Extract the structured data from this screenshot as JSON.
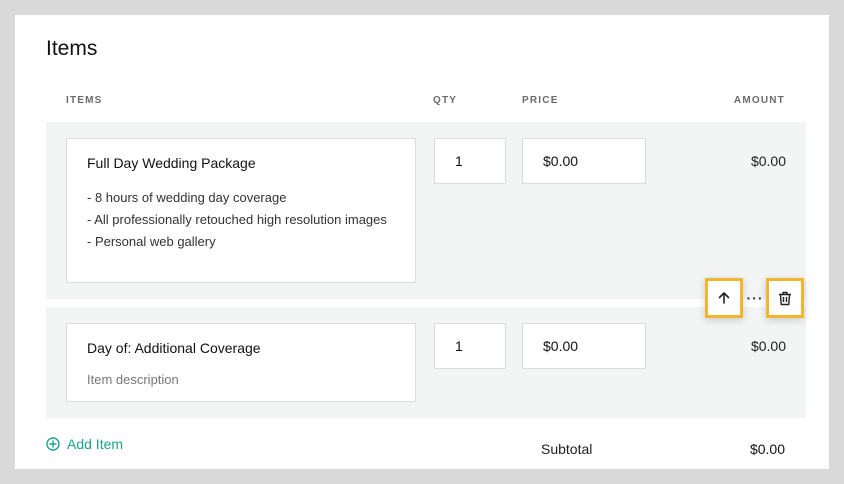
{
  "section": {
    "title": "Items"
  },
  "columns": {
    "items": "ITEMS",
    "qty": "QTY",
    "price": "PRICE",
    "amount": "AMOUNT"
  },
  "items": [
    {
      "name": "Full Day Wedding Package",
      "description": [
        "- 8 hours of wedding day coverage",
        "- All professionally retouched high resolution images",
        "- Personal web gallery"
      ],
      "qty": "1",
      "price": "$0.00",
      "amount": "$0.00"
    },
    {
      "name": "Day of: Additional Coverage",
      "description_placeholder": "Item description",
      "qty": "1",
      "price": "$0.00",
      "amount": "$0.00"
    }
  ],
  "row_actions": {
    "more_label": "···",
    "highlight_color": "#f2b530"
  },
  "footer": {
    "add_item_label": "Add Item",
    "subtotal_label": "Subtotal",
    "subtotal_value": "$0.00"
  },
  "colors": {
    "accent": "#1ba38a",
    "row_bg": "#f3f5f4"
  },
  "icons": {
    "move_up": "arrow-up-icon",
    "delete": "trash-icon",
    "add": "plus-circle-icon"
  }
}
